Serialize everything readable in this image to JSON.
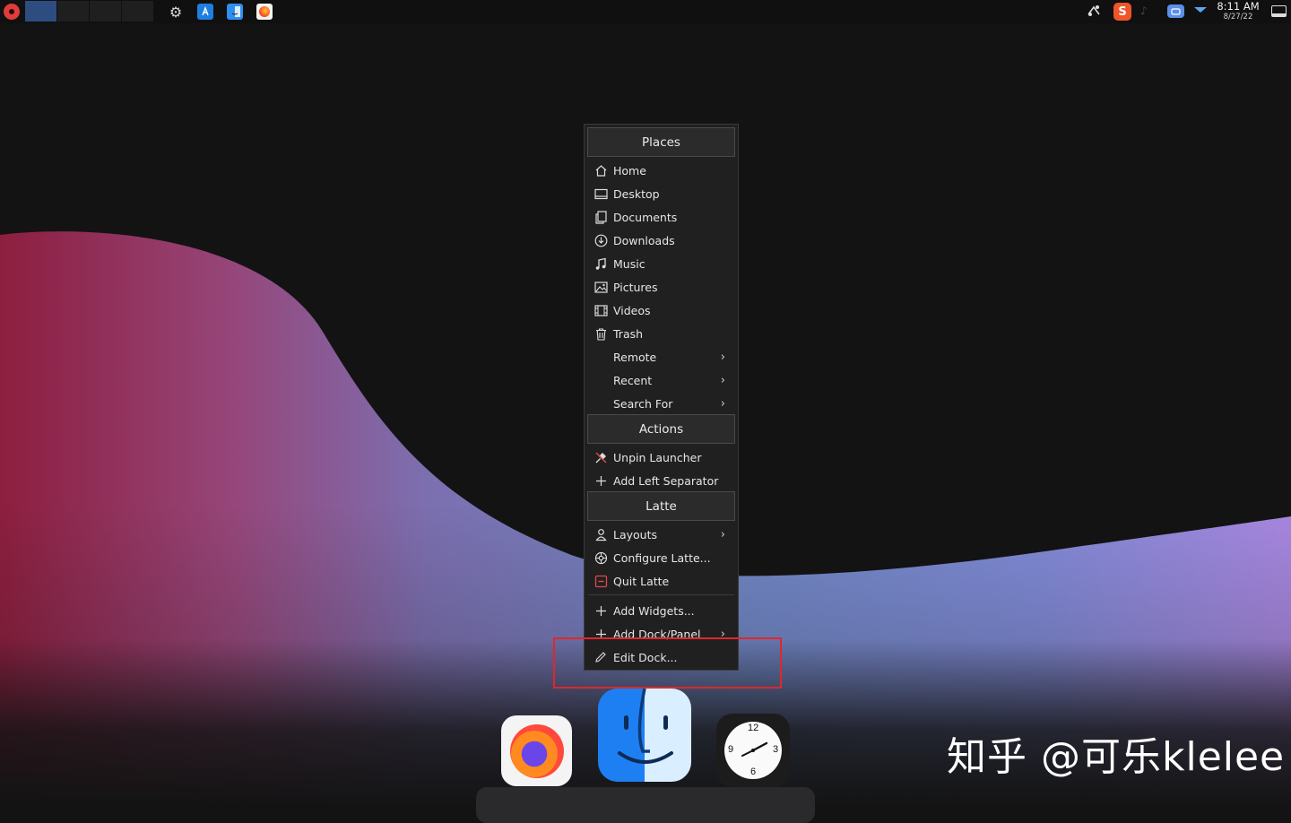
{
  "top_panel": {
    "clock": {
      "time": "8:11 AM",
      "date": "8/27/22"
    },
    "tray": {
      "sogou_label": "S"
    }
  },
  "context_menu": {
    "sections": [
      {
        "header": "Places"
      },
      {
        "header": "Actions"
      },
      {
        "header": "Latte"
      }
    ],
    "places": [
      {
        "label": "Home",
        "icon": "home-icon"
      },
      {
        "label": "Desktop",
        "icon": "desktop-icon"
      },
      {
        "label": "Documents",
        "icon": "documents-icon"
      },
      {
        "label": "Downloads",
        "icon": "downloads-icon"
      },
      {
        "label": "Music",
        "icon": "music-icon"
      },
      {
        "label": "Pictures",
        "icon": "pictures-icon"
      },
      {
        "label": "Videos",
        "icon": "videos-icon"
      },
      {
        "label": "Trash",
        "icon": "trash-icon"
      },
      {
        "label": "Remote",
        "submenu": true
      },
      {
        "label": "Recent",
        "submenu": true
      },
      {
        "label": "Search For",
        "submenu": true
      }
    ],
    "actions": [
      {
        "label": "Unpin Launcher",
        "icon": "unpin-icon"
      },
      {
        "label": "Add Left Separator",
        "icon": "plus-icon"
      }
    ],
    "latte": [
      {
        "label": "Layouts",
        "icon": "user-icon",
        "submenu": true
      },
      {
        "label": "Configure Latte...",
        "icon": "settings-icon"
      },
      {
        "label": "Quit Latte",
        "icon": "quit-icon",
        "icon_color": "#e0474c"
      }
    ],
    "dock": [
      {
        "label": "Add Widgets...",
        "icon": "plus-icon"
      },
      {
        "label": "Add Dock/Panel",
        "icon": "plus-icon",
        "submenu": true
      },
      {
        "label": "Edit Dock...",
        "icon": "pencil-icon"
      }
    ]
  },
  "dock": {
    "apps": [
      {
        "name": "Firefox",
        "icon": "firefox-icon"
      },
      {
        "name": "Finder",
        "icon": "finder-icon"
      },
      {
        "name": "Clock",
        "icon": "clock-icon"
      }
    ],
    "clock_numbers": {
      "n12": "12",
      "n3": "3",
      "n6": "6",
      "n9": "9"
    }
  },
  "watermark": {
    "text": "知乎 @可乐klelee"
  },
  "colors": {
    "highlight_box": "#e0272c",
    "pager_active": "#2d4d80",
    "menu_bg": "#202020"
  }
}
